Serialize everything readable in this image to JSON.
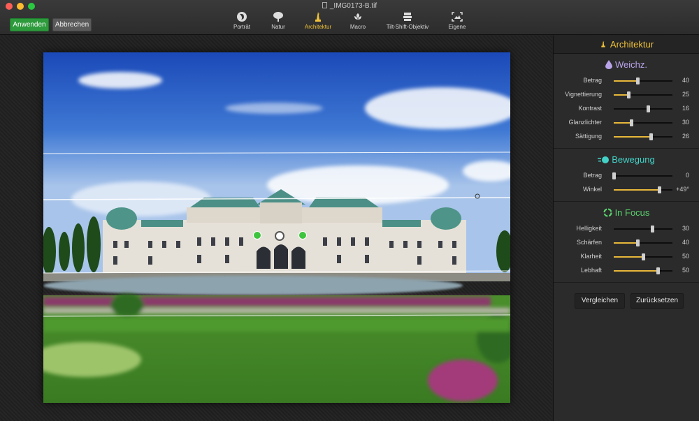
{
  "window": {
    "title": "_IMG0173-B.tif"
  },
  "toolbar": {
    "apply_label": "Anwenden",
    "cancel_label": "Abbrechen",
    "modes": [
      {
        "label": "Porträt",
        "icon": "portrait-icon"
      },
      {
        "label": "Natur",
        "icon": "tree-icon"
      },
      {
        "label": "Architektur",
        "icon": "statue-icon",
        "active": true
      },
      {
        "label": "Macro",
        "icon": "flower-icon"
      },
      {
        "label": "Tilt-Shift-Objektiv",
        "icon": "lens-icon"
      },
      {
        "label": "Eigene",
        "icon": "custom-frame-icon"
      }
    ]
  },
  "panel": {
    "title": "Architektur",
    "sections": [
      {
        "title": "Weichz.",
        "icon": "drop-icon",
        "sliders": [
          {
            "label": "Betrag",
            "value": "40",
            "level": 0.4,
            "fill": true
          },
          {
            "label": "Vignettierung",
            "value": "25",
            "level": 0.25,
            "fill": true
          },
          {
            "label": "Kontrast",
            "value": "16",
            "level": 0.58,
            "fill": false
          },
          {
            "label": "Glanzlichter",
            "value": "30",
            "level": 0.3,
            "fill": true
          },
          {
            "label": "Sättigung",
            "value": "26",
            "level": 0.63,
            "fill": true
          }
        ]
      },
      {
        "title": "Bewegung",
        "icon": "motion-icon",
        "sliders": [
          {
            "label": "Betrag",
            "value": "0",
            "level": 0.0,
            "fill": false
          },
          {
            "label": "Winkel",
            "value": "+49°",
            "level": 0.77,
            "fill": true
          }
        ]
      },
      {
        "title": "In Focus",
        "icon": "focus-icon",
        "sliders": [
          {
            "label": "Helligkeit",
            "value": "30",
            "level": 0.65,
            "fill": false
          },
          {
            "label": "Schärfen",
            "value": "40",
            "level": 0.4,
            "fill": true
          },
          {
            "label": "Klarheit",
            "value": "50",
            "level": 0.5,
            "fill": true
          },
          {
            "label": "Lebhaft",
            "value": "50",
            "level": 0.75,
            "fill": true
          }
        ]
      }
    ],
    "compare_label": "Vergleichen",
    "reset_label": "Zurücksetzen"
  },
  "colors": {
    "accent": "#f0c23a",
    "apply": "#2d9a3c",
    "handle": "#3ec43e"
  }
}
